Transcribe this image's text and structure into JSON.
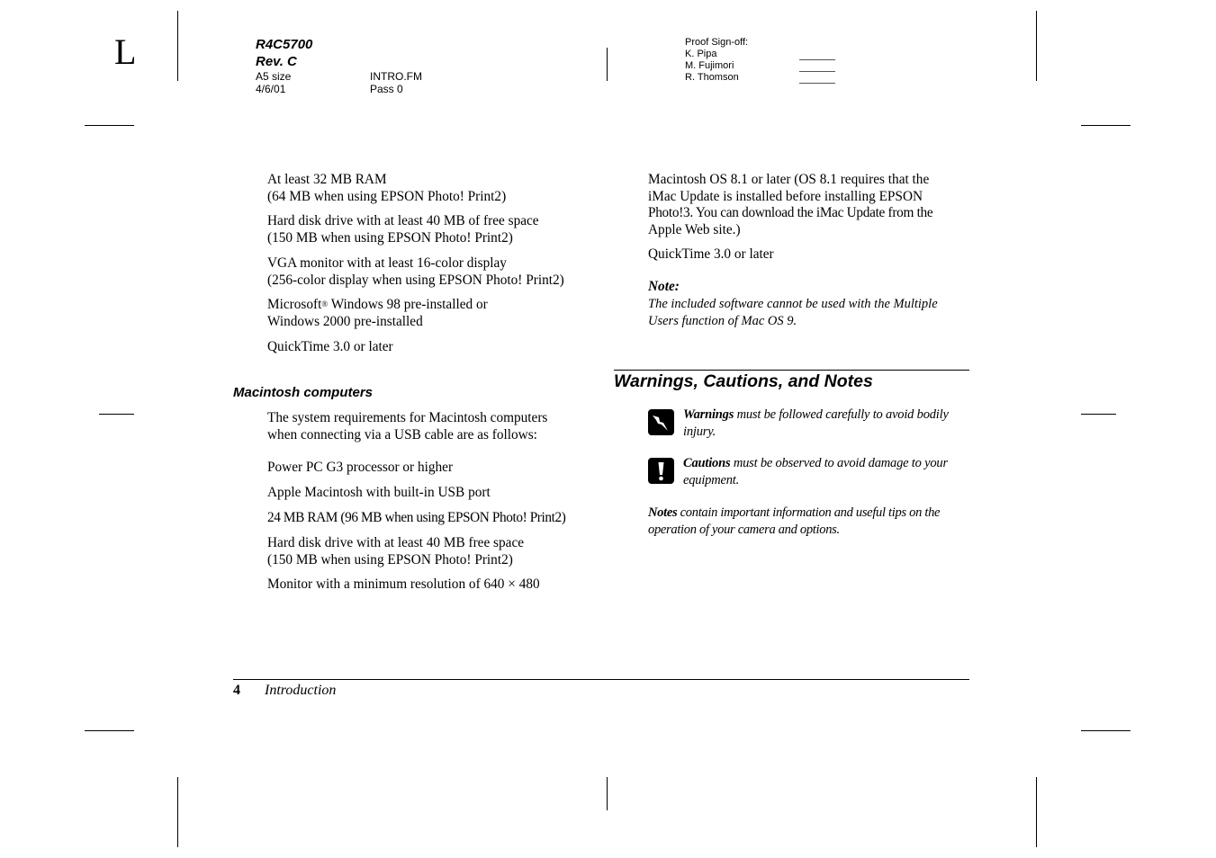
{
  "slug": {
    "side_letter": "L",
    "product": "R4C5700",
    "revision": "Rev. C",
    "size": "A5 size",
    "date": "4/6/01",
    "file": "INTRO.FM",
    "pass": "Pass 0"
  },
  "proof_signoff": {
    "label": "Proof Sign-off:",
    "names": [
      "K. Pipa",
      "M. Fujimori",
      "R. Thomson"
    ]
  },
  "left_column": {
    "windows_requirements": [
      [
        "At least 32 MB RAM",
        "(64 MB when using EPSON Photo! Print2)"
      ],
      [
        "Hard disk drive with at least 40 MB of free space",
        "(150 MB when using EPSON Photo! Print2)"
      ],
      [
        "VGA monitor with at least 16-color display",
        "(256-color display when using EPSON Photo! Print2)"
      ],
      [
        "Microsoft",
        "®",
        " Windows 98 pre-installed or",
        "Windows 2000 pre-installed"
      ],
      [
        "QuickTime 3.0 or later"
      ]
    ],
    "mac_heading": "Macintosh computers",
    "mac_intro": [
      "The system requirements for Macintosh computers",
      "when connecting via a USB cable are as follows:"
    ],
    "mac_requirements": [
      [
        "Power PC G3 processor or higher"
      ],
      [
        "Apple Macintosh with built-in USB port"
      ],
      [
        "24 MB RAM (96 MB when using EPSON Photo! Print2)"
      ],
      [
        "Hard disk drive with at least 40 MB free space",
        "(150 MB when using EPSON Photo! Print2)"
      ],
      [
        "Monitor with a minimum resolution of 640 × 480"
      ]
    ]
  },
  "right_column": {
    "mac_os": [
      "Macintosh OS 8.1 or later (OS 8.1 requires that the",
      "iMac Update is installed before installing EPSON",
      "Photo!3. You can download the iMac Update from the",
      "Apple Web site.)"
    ],
    "quicktime": "QuickTime 3.0 or later",
    "note_label": "Note:",
    "note_text": [
      "The included software cannot be used with the Multiple",
      "Users function of Mac OS 9."
    ],
    "section_heading": "Warnings, Cautions, and Notes",
    "warnings": {
      "icon": "lightning-warning-icon",
      "bold": "Warnings",
      "rest": " must be followed carefully to avoid bodily",
      "line2": "injury."
    },
    "cautions": {
      "icon": "exclamation-caution-icon",
      "bold": "Cautions",
      "rest": " must be observed to avoid damage to your",
      "line2": "equipment."
    },
    "notes": {
      "bold": "Notes",
      "rest": " contain important information and useful tips on the",
      "line2": "operation of your camera and options."
    }
  },
  "footer": {
    "page_number": "4",
    "chapter": "Introduction"
  }
}
